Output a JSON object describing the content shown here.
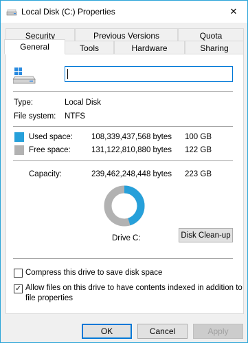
{
  "window": {
    "title": "Local Disk (C:) Properties",
    "close_glyph": "✕"
  },
  "tabs": {
    "row1": [
      "Security",
      "Previous Versions",
      "Quota"
    ],
    "row2": [
      "General",
      "Tools",
      "Hardware",
      "Sharing"
    ],
    "active": "General"
  },
  "general": {
    "volume_label_value": "",
    "type_label": "Type:",
    "type_value": "Local Disk",
    "fs_label": "File system:",
    "fs_value": "NTFS",
    "used_label": "Used space:",
    "used_bytes": "108,339,437,568 bytes",
    "used_gb": "100 GB",
    "free_label": "Free space:",
    "free_bytes": "131,122,810,880 bytes",
    "free_gb": "122 GB",
    "capacity_label": "Capacity:",
    "capacity_bytes": "239,462,248,448 bytes",
    "capacity_gb": "223 GB",
    "drive_label": "Drive C:",
    "cleanup_button": "Disk Clean-up",
    "used_fraction": 0.4524,
    "used_color": "#26a0da",
    "free_color": "#b2b2b2"
  },
  "options": {
    "compress_label": "Compress this drive to save disk space",
    "compress_checked": false,
    "index_label_line1": "Allow files on this drive to have contents indexed in addition to",
    "index_label_line2": "file properties",
    "index_checked": true,
    "check_glyph": "✓"
  },
  "buttons": {
    "ok": "OK",
    "cancel": "Cancel",
    "apply": "Apply"
  }
}
